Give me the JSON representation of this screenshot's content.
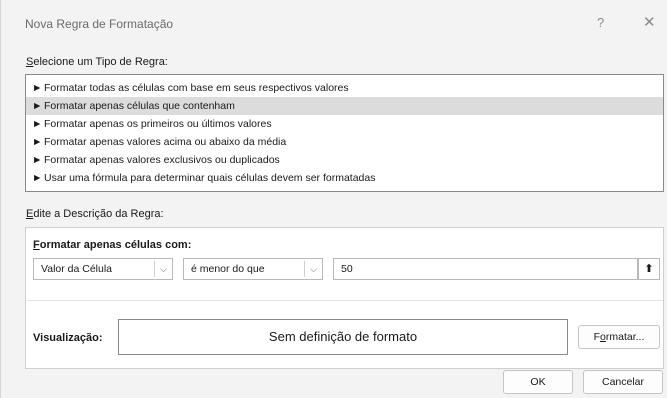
{
  "dialog": {
    "title": "Nova Regra de Formatação",
    "help_label": "?",
    "close_label": "✕"
  },
  "rule_type": {
    "label_hotkey": "S",
    "label_rest": "elecione um Tipo de Regra:",
    "arrow_glyph": "►",
    "items": [
      {
        "label": "Formatar todas as células com base em seus respectivos valores",
        "selected": false
      },
      {
        "label": "Formatar apenas células que contenham",
        "selected": true
      },
      {
        "label": "Formatar apenas os primeiros ou últimos valores",
        "selected": false
      },
      {
        "label": "Formatar apenas valores acima ou abaixo da média",
        "selected": false
      },
      {
        "label": "Formatar apenas valores exclusivos ou duplicados",
        "selected": false
      },
      {
        "label": "Usar uma fórmula para determinar quais células devem ser formatadas",
        "selected": false
      }
    ]
  },
  "description": {
    "label_hotkey": "E",
    "label_rest": "dite a Descrição da Regra:",
    "subheading_hotkey": "F",
    "subheading_rest": "ormatar apenas células com:",
    "condition_type": "Valor da Célula",
    "operator": "é menor do que",
    "value": "50",
    "ref_icon": "⬆"
  },
  "preview": {
    "label": "Visualização:",
    "text": "Sem definição de formato",
    "format_button_pre": "F",
    "format_button_hotkey": "o",
    "format_button_post": "rmatar..."
  },
  "buttons": {
    "ok": "OK",
    "cancel": "Cancelar"
  },
  "colors": {
    "selected_row": "#dcdcdc",
    "dialog_bg": "#f3f3f3"
  }
}
